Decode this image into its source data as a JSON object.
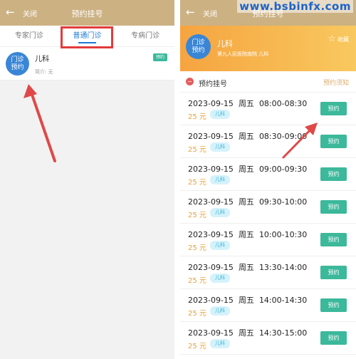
{
  "left": {
    "header": {
      "back_icon": "←",
      "close": "关闭",
      "title": "预约挂号"
    },
    "tabs": [
      {
        "label": "专家门诊",
        "active": false
      },
      {
        "label": "普通门诊",
        "active": true
      },
      {
        "label": "专病门诊",
        "active": false
      }
    ],
    "department": {
      "badge": "门诊预约",
      "badge_line1": "门诊",
      "badge_line2": "预约",
      "name": "儿科",
      "intro": "简介: 无",
      "tag": "预约"
    }
  },
  "right": {
    "header": {
      "back_icon": "←",
      "close": "关闭",
      "title": "预约挂号"
    },
    "card": {
      "badge_line1": "门诊",
      "badge_line2": "预约",
      "name": "儿科",
      "hospital": "第九人民医院南院  儿科",
      "favorite_icon": "☆",
      "favorite": "收藏"
    },
    "section": {
      "icon": "−",
      "title": "预约挂号",
      "notice": "预约须知"
    },
    "slots": [
      {
        "date": "2023-09-15",
        "weekday": "周五",
        "time": "08:00-08:30",
        "price": "25 元",
        "dept": "儿科",
        "button": "预约"
      },
      {
        "date": "2023-09-15",
        "weekday": "周五",
        "time": "08:30-09:00",
        "price": "25 元",
        "dept": "儿科",
        "button": "预约"
      },
      {
        "date": "2023-09-15",
        "weekday": "周五",
        "time": "09:00-09:30",
        "price": "25 元",
        "dept": "儿科",
        "button": "预约"
      },
      {
        "date": "2023-09-15",
        "weekday": "周五",
        "time": "09:30-10:00",
        "price": "25 元",
        "dept": "儿科",
        "button": "预约"
      },
      {
        "date": "2023-09-15",
        "weekday": "周五",
        "time": "10:00-10:30",
        "price": "25 元",
        "dept": "儿科",
        "button": "预约"
      },
      {
        "date": "2023-09-15",
        "weekday": "周五",
        "time": "13:30-14:00",
        "price": "25 元",
        "dept": "儿科",
        "button": "预约"
      },
      {
        "date": "2023-09-15",
        "weekday": "周五",
        "time": "14:00-14:30",
        "price": "25 元",
        "dept": "儿科",
        "button": "预约"
      },
      {
        "date": "2023-09-15",
        "weekday": "周五",
        "time": "14:30-15:00",
        "price": "25 元",
        "dept": "儿科",
        "button": "预约"
      }
    ]
  },
  "watermark": "www.bsbinfx.com",
  "colors": {
    "header": "#ccb183",
    "active_tab": "#1d79d5",
    "highlight": "#e23b3b",
    "book_button": "#3cb89b",
    "price": "#e8a23c",
    "arrow": "#e04848"
  }
}
